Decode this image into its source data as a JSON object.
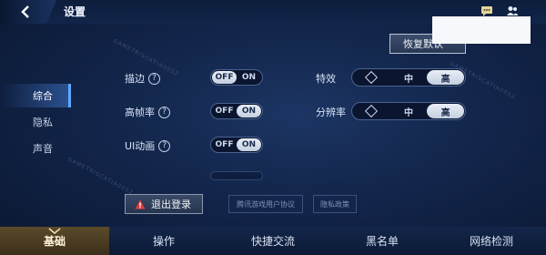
{
  "header": {
    "title": "设置"
  },
  "restore_button": {
    "label": "恢复默认"
  },
  "watermark": "GAMETRISCATIA0052",
  "sidebar": {
    "items": [
      {
        "label": "综合",
        "active": true
      },
      {
        "label": "隐私",
        "active": false
      },
      {
        "label": "声音",
        "active": false
      }
    ]
  },
  "settings": {
    "outline": {
      "label": "描边",
      "off": "OFF",
      "on": "ON",
      "value": "OFF"
    },
    "high_fps": {
      "label": "高帧率",
      "off": "OFF",
      "on": "ON",
      "value": "ON"
    },
    "ui_anim": {
      "label": "UI动画",
      "off": "OFF",
      "on": "ON",
      "value": "ON"
    },
    "effects": {
      "label": "特效",
      "opt_mid": "中",
      "opt_high": "高",
      "value": "高"
    },
    "resolution": {
      "label": "分辨率",
      "opt_mid": "中",
      "opt_high": "高",
      "value": "高"
    },
    "help_glyph": "?"
  },
  "actions": {
    "logout": "退出登录",
    "user_agreement": "腾讯游戏用户协议",
    "privacy_policy": "隐私政策"
  },
  "bottom_nav": [
    {
      "label": "基础",
      "active": true
    },
    {
      "label": "操作",
      "active": false
    },
    {
      "label": "快捷交流",
      "active": false
    },
    {
      "label": "黑名单",
      "active": false
    },
    {
      "label": "网络检测",
      "active": false
    }
  ],
  "colors": {
    "accent": "#5fa8ff",
    "active_tab": "#5b4a2a",
    "warning": "#e03b3b"
  }
}
